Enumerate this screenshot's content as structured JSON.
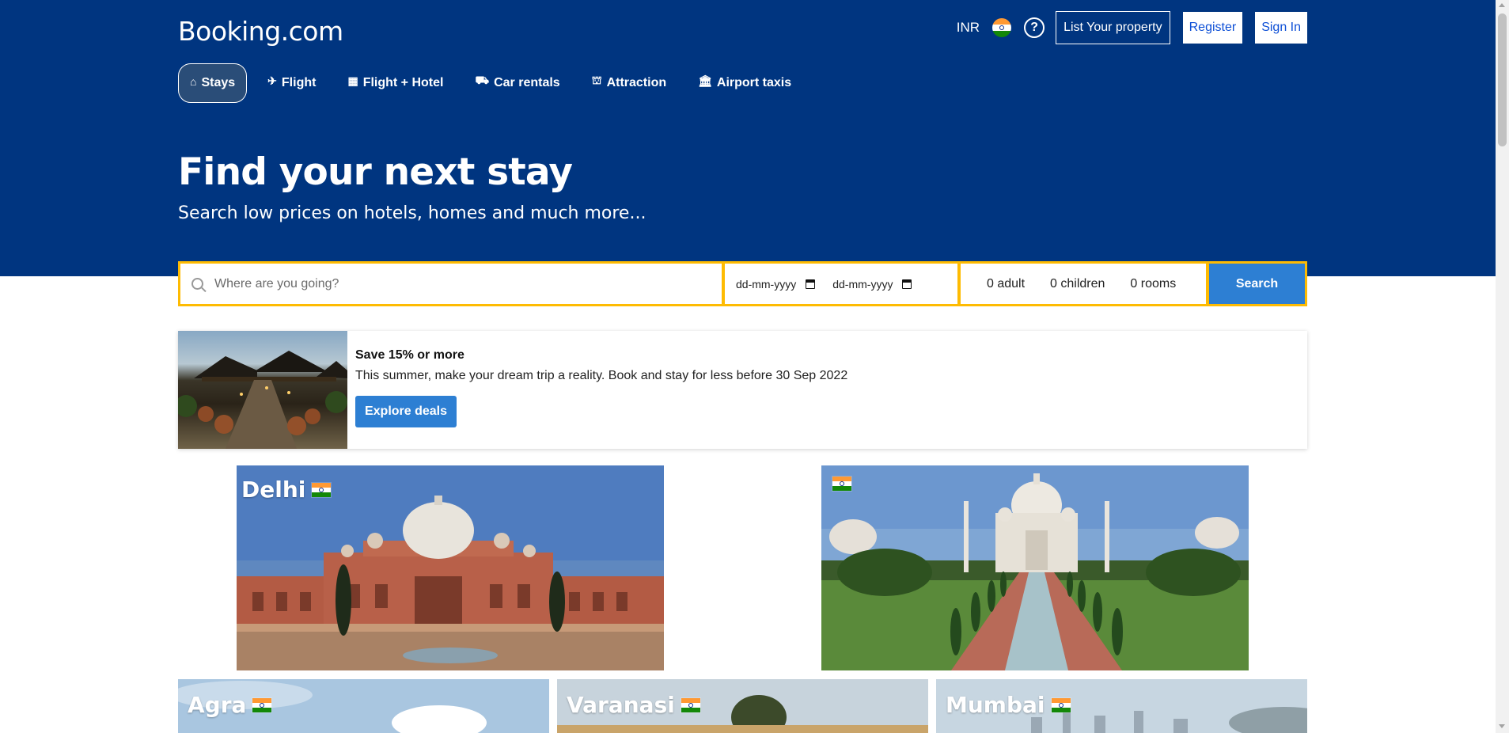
{
  "header": {
    "logo": "Booking.com",
    "currency": "INR",
    "help_symbol": "?",
    "list_property": "List Your property",
    "register": "Register",
    "sign_in": "Sign In"
  },
  "nav": {
    "items": [
      {
        "label": "Stays",
        "icon": "home-icon",
        "active": true
      },
      {
        "label": "Flight",
        "icon": "plane-icon"
      },
      {
        "label": "Flight + Hotel",
        "icon": "building-icon"
      },
      {
        "label": "Car rentals",
        "icon": "car-icon"
      },
      {
        "label": "Attraction",
        "icon": "attraction-icon"
      },
      {
        "label": "Airport taxis",
        "icon": "taxi-icon"
      }
    ]
  },
  "hero": {
    "title": "Find your next stay",
    "subtitle": "Search low prices on hotels, homes and much more..."
  },
  "search": {
    "destination_placeholder": "Where are you going?",
    "checkin_placeholder": "dd-mm-yyyy",
    "checkout_placeholder": "dd-mm-yyyy",
    "adults": "0 adult",
    "children": "0 children",
    "rooms": "0 rooms",
    "button": "Search"
  },
  "promo": {
    "title": "Save 15% or more",
    "description": "This summer, make your dream trip a reality. Book and stay for less before 30 Sep 2022",
    "button": "Explore deals"
  },
  "cities": [
    {
      "name": "Delhi"
    },
    {
      "name": ""
    },
    {
      "name": "Agra"
    },
    {
      "name": "Varanasi"
    },
    {
      "name": "Mumbai"
    }
  ],
  "colors": {
    "brand_blue": "#003580",
    "search_border": "#febb02",
    "button_blue": "#2d7fd3",
    "flag_saffron": "#ff9933",
    "flag_green": "#138808"
  }
}
